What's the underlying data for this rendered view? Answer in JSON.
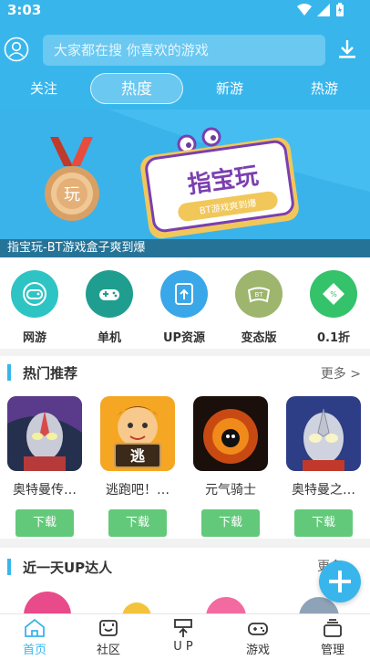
{
  "status": {
    "time": "3:03"
  },
  "search": {
    "placeholder": "大家都在搜  你喜欢的游戏"
  },
  "tabs": [
    {
      "label": "关注"
    },
    {
      "label": "热度",
      "active": true
    },
    {
      "label": "新游"
    },
    {
      "label": "热游"
    }
  ],
  "banner": {
    "caption": "指宝玩-BT游戏盒子爽到爆",
    "logo_text": "指宝玩",
    "ribbon_text": "BT游戏爽到爆",
    "medal_text": "玩"
  },
  "categories": [
    {
      "label": "网游",
      "icon": "gamepad-icon",
      "color": "#2ec4c4"
    },
    {
      "label": "单机",
      "icon": "controller-icon",
      "color": "#1f9e8f"
    },
    {
      "label": "UP资源",
      "icon": "upload-icon",
      "color": "#3aa7e8"
    },
    {
      "label": "变态版",
      "icon": "bt-gamepad-icon",
      "color": "#9db56c"
    },
    {
      "label": "0.1折",
      "icon": "discount-tag-icon",
      "color": "#34c26b"
    }
  ],
  "hot": {
    "title": "热门推荐",
    "more": "更多 >",
    "games": [
      {
        "name": "奥特曼传…",
        "button": "下载"
      },
      {
        "name": "逃跑吧！…",
        "button": "下载",
        "icon_text": "逃"
      },
      {
        "name": "元气骑士",
        "button": "下载"
      },
      {
        "name": "奥特曼之…",
        "button": "下载"
      }
    ]
  },
  "up": {
    "title": "近一天UP达人",
    "more": "更多"
  },
  "nav": [
    {
      "label": "首页",
      "active": true
    },
    {
      "label": "社区"
    },
    {
      "label": "U P"
    },
    {
      "label": "游戏"
    },
    {
      "label": "管理"
    }
  ],
  "colors": {
    "primary": "#38b6ec",
    "download": "#63c97a"
  }
}
